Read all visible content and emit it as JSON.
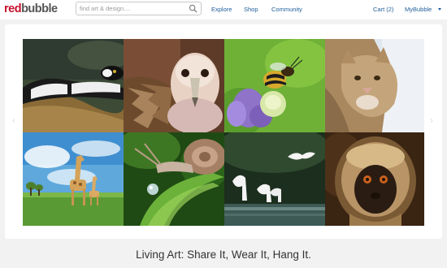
{
  "header": {
    "logo": {
      "part1": "red",
      "part2": "bubble"
    },
    "search": {
      "placeholder": "find art & design....",
      "icon": "search-icon"
    },
    "nav": [
      "Explore",
      "Shop",
      "Community"
    ],
    "cart_label": "Cart (2)",
    "account_label": "MyBubble",
    "account_icon": "chevron-down-icon"
  },
  "gallery": {
    "prev_arrow": "‹",
    "next_arrow": "›",
    "tiles": [
      {
        "subject": "lemur-lying-on-branch"
      },
      {
        "subject": "vulture-portrait"
      },
      {
        "subject": "bee-on-purple-flower"
      },
      {
        "subject": "cougar-in-snow"
      },
      {
        "subject": "giraffes-on-meadow"
      },
      {
        "subject": "snail-with-water-drop"
      },
      {
        "subject": "egrets-in-flight"
      },
      {
        "subject": "monkey-portrait"
      }
    ]
  },
  "tagline": "Living Art: Share It, Wear It, Hang It.",
  "colors": {
    "brand_red": "#c8102e",
    "link_blue": "#1f5e9c",
    "page_bg": "#f2f2f2"
  }
}
